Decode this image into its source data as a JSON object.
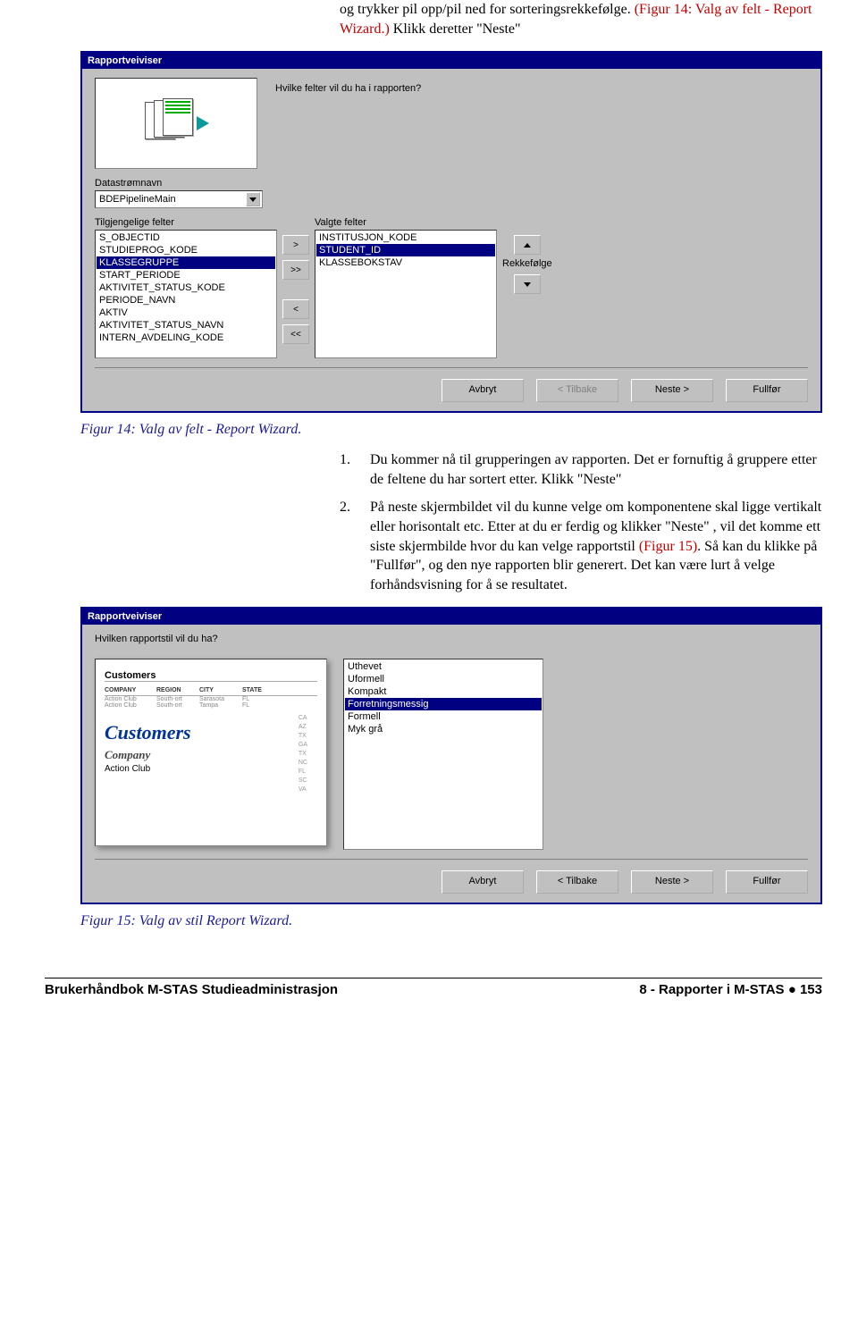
{
  "intro": {
    "part1": "og trykker pil opp/pil ned for sorteringsrekkefølge. ",
    "red1": "(Figur 14: Valg av felt - Report Wizard.)",
    "part2": " Klikk deretter \"Neste\""
  },
  "wiz1": {
    "title": "Rapportveiviser",
    "prompt": "Hvilke felter vil du ha i rapporten?",
    "datastrom_label": "Datastrømnavn",
    "datastrom_value": "BDEPipelineMain",
    "avail_label": "Tilgjengelige felter",
    "avail": [
      "S_OBJECTID",
      "STUDIEPROG_KODE",
      "KLASSEGRUPPE",
      "START_PERIODE",
      "AKTIVITET_STATUS_KODE",
      "PERIODE_NAVN",
      "AKTIV",
      "AKTIVITET_STATUS_NAVN",
      "INTERN_AVDELING_KODE"
    ],
    "avail_selected_index": 2,
    "sel_label": "Valgte felter",
    "sel": [
      "INSTITUSJON_KODE",
      "STUDENT_ID",
      "KLASSEBOKSTAV"
    ],
    "sel_selected_index": 1,
    "order_label": "Rekkefølge",
    "btn_add": ">",
    "btn_add_all": ">>",
    "btn_remove": "<",
    "btn_remove_all": "<<",
    "footer": {
      "avbryt": "Avbryt",
      "tilbake": "< Tilbake",
      "neste": "Neste >",
      "fullfor": "Fullfør"
    }
  },
  "caption1": "Figur 14: Valg av felt - Report Wizard.",
  "list": {
    "item1_num": "1.",
    "item1": "Du kommer nå til grupperingen av rapporten. Det er fornuftig å gruppere etter de feltene du har sortert etter. Klikk \"Neste\"",
    "item2_num": "2.",
    "item2_a": "På neste skjermbildet vil du kunne velge om komponentene skal ligge vertikalt eller horisontalt etc. Etter at du er ferdig og klikker \"Neste\" , vil det komme ett siste skjermbilde hvor du kan velge rapportstil ",
    "item2_red": "(Figur 15)",
    "item2_b": ". Så kan du klikke på \"Fullfør\", og den nye rapporten blir generert. Det kan være lurt å velge forhåndsvisning for å se resultatet."
  },
  "wiz2": {
    "title": "Rapportveiviser",
    "prompt": "Hvilken rapportstil vil du ha?",
    "styles": [
      "Uthevet",
      "Uformell",
      "Kompakt",
      "Forretningsmessig",
      "Formell",
      "Myk grå"
    ],
    "styles_selected_index": 3,
    "preview": {
      "h1": "Customers",
      "th": [
        "COMPANY",
        "REGION",
        "CITY",
        "STATE"
      ],
      "r1": [
        "Action Club",
        "South-ort",
        "Sarasota",
        "FL"
      ],
      "r2": [
        "Action Club",
        "South-ort",
        "Tampa",
        "FL"
      ],
      "states": [
        "CA",
        "AZ",
        "TX",
        "GA",
        "TX",
        "NC",
        "FL",
        "SC",
        "VA"
      ],
      "big1": "Customers",
      "big2": "Company",
      "big3": "Action Club"
    },
    "footer": {
      "avbryt": "Avbryt",
      "tilbake": "< Tilbake",
      "neste": "Neste >",
      "fullfor": "Fullfør"
    }
  },
  "caption2": "Figur 15: Valg av stil Report Wizard.",
  "footer": {
    "left": "Brukerhåndbok M-STAS Studieadministrasjon",
    "right_a": "8 - Rapporter i M-STAS ",
    "right_b": " 153"
  }
}
